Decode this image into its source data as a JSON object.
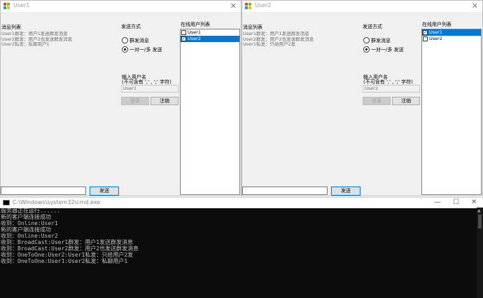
{
  "window1": {
    "title": "User1",
    "message_list_label": "消息列表",
    "messages": [
      "User1群发：用户1发送群发消息",
      "User2群发：用户2也发送群发消息",
      "User2私发：私聊用户1"
    ],
    "send_mode_label": "发送方式",
    "radio_broadcast": "群发消息",
    "radio_private": "一对一/多 发送",
    "online_list_label": "在线用户列表",
    "users": [
      {
        "name": "User1",
        "checked": false,
        "selected": false
      },
      {
        "name": "User2",
        "checked": true,
        "selected": true
      }
    ],
    "username_label_line1": "输入用户名",
    "username_label_line2": "(不可含有 ',' , ';' 字符)",
    "username_value": "User1",
    "login_button": "登录",
    "logout_button": "注销",
    "send_button": "发送",
    "send_input_value": ""
  },
  "window2": {
    "title": "User2",
    "message_list_label": "消息列表",
    "messages": [
      "User1群发：用户1发送群发消息",
      "User2群发：用户2也发送群发消息",
      "User1私发：只给用户2发"
    ],
    "send_mode_label": "发送方式",
    "radio_broadcast": "群发消息",
    "radio_private": "一对一/多 发送",
    "online_list_label": "在线用户列表",
    "users": [
      {
        "name": "User1",
        "checked": true,
        "selected": true
      },
      {
        "name": "User2",
        "checked": false,
        "selected": false
      }
    ],
    "username_label_line1": "输入用户名",
    "username_label_line2": "(不可含有 ',' , ';' 字符)",
    "username_value": "User2",
    "login_button": "登录",
    "logout_button": "注销",
    "send_button": "发送",
    "send_input_value": ""
  },
  "console": {
    "title": "C:\\Windows\\system32\\cmd.exe",
    "lines": [
      "服务器正在运行......",
      "新的客户端连接成功",
      "收到：Online:User1",
      "新的客户端连接成功",
      "收到：Online:User2",
      "收到：BroadCast:User1群发：用户1发送群发消息",
      "收到：BroadCast:User2群发：用户2也发送群发消息",
      "收到：OneToOne:User2:User1私发：只给用户2发",
      "收到：OneToOne:User1:User2私发：私聊用户1"
    ]
  },
  "colors": {
    "accent": "#0078d7",
    "console_bg": "#0c0c0c",
    "console_text": "#c0c0c0"
  },
  "icons": {
    "window_icon": "winforms-app-icon",
    "console_icon": "cmd-icon",
    "close": "close-icon"
  }
}
